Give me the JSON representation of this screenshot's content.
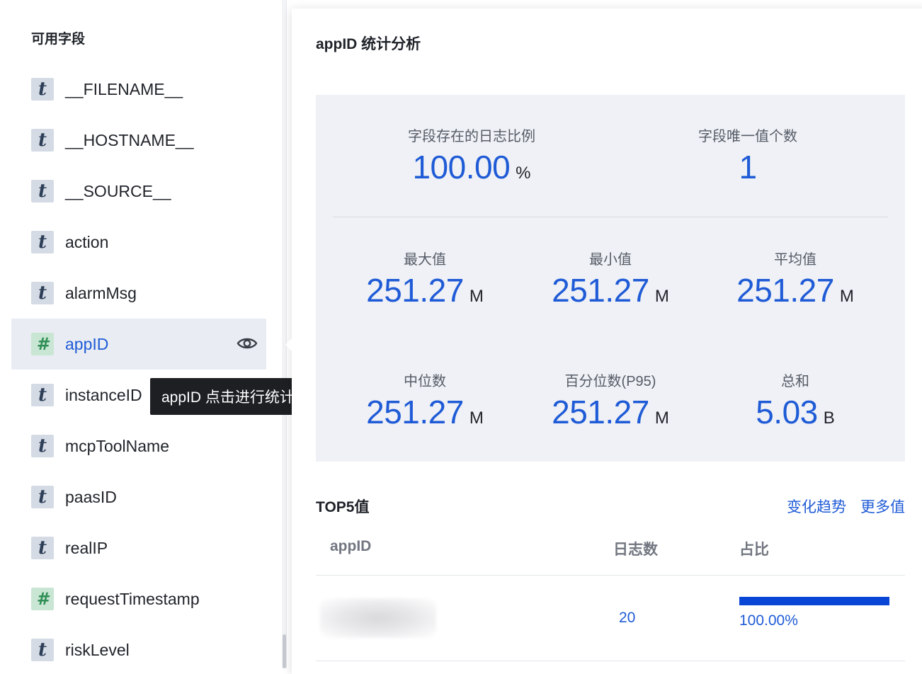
{
  "left_panel": {
    "title": "可用字段",
    "fields": [
      {
        "type": "t",
        "name": "__FILENAME__",
        "selected": false
      },
      {
        "type": "t",
        "name": "__HOSTNAME__",
        "selected": false
      },
      {
        "type": "t",
        "name": "__SOURCE__",
        "selected": false
      },
      {
        "type": "t",
        "name": "action",
        "selected": false
      },
      {
        "type": "t",
        "name": "alarmMsg",
        "selected": false
      },
      {
        "type": "#",
        "name": "appID",
        "selected": true
      },
      {
        "type": "t",
        "name": "instanceID",
        "selected": false
      },
      {
        "type": "t",
        "name": "mcpToolName",
        "selected": false
      },
      {
        "type": "t",
        "name": "paasID",
        "selected": false
      },
      {
        "type": "t",
        "name": "realIP",
        "selected": false
      },
      {
        "type": "#",
        "name": "requestTimestamp",
        "selected": false
      },
      {
        "type": "t",
        "name": "riskLevel",
        "selected": false
      }
    ],
    "tooltip": "appID 点击进行统计分析",
    "icons": {
      "text_type": "t-type-icon",
      "number_type": "hash-type-icon",
      "preview": "eye-icon"
    }
  },
  "popover": {
    "title": "appID 统计分析",
    "stats": {
      "exist_ratio": {
        "label": "字段存在的日志比例",
        "value": "100.00",
        "unit": "%"
      },
      "unique_count": {
        "label": "字段唯一值个数",
        "value": "1",
        "unit": ""
      },
      "max": {
        "label": "最大值",
        "value": "251.27",
        "unit": "M"
      },
      "min": {
        "label": "最小值",
        "value": "251.27",
        "unit": "M"
      },
      "avg": {
        "label": "平均值",
        "value": "251.27",
        "unit": "M"
      },
      "median": {
        "label": "中位数",
        "value": "251.27",
        "unit": "M"
      },
      "p95": {
        "label": "百分位数(P95)",
        "value": "251.27",
        "unit": "M"
      },
      "sum": {
        "label": "总和",
        "value": "5.03",
        "unit": "B"
      }
    },
    "top5": {
      "title": "TOP5值",
      "trend_link": "变化趋势",
      "more_link": "更多值",
      "columns": {
        "value": "appID",
        "count": "日志数",
        "ratio": "占比"
      },
      "rows": [
        {
          "value": "",
          "count": "20",
          "ratio": "100.00%",
          "ratio_fraction": 1.0
        }
      ]
    },
    "colors": {
      "accent": "#1f5bd6",
      "bar": "#0a46d6",
      "stats_bg": "#eff1f6"
    }
  }
}
